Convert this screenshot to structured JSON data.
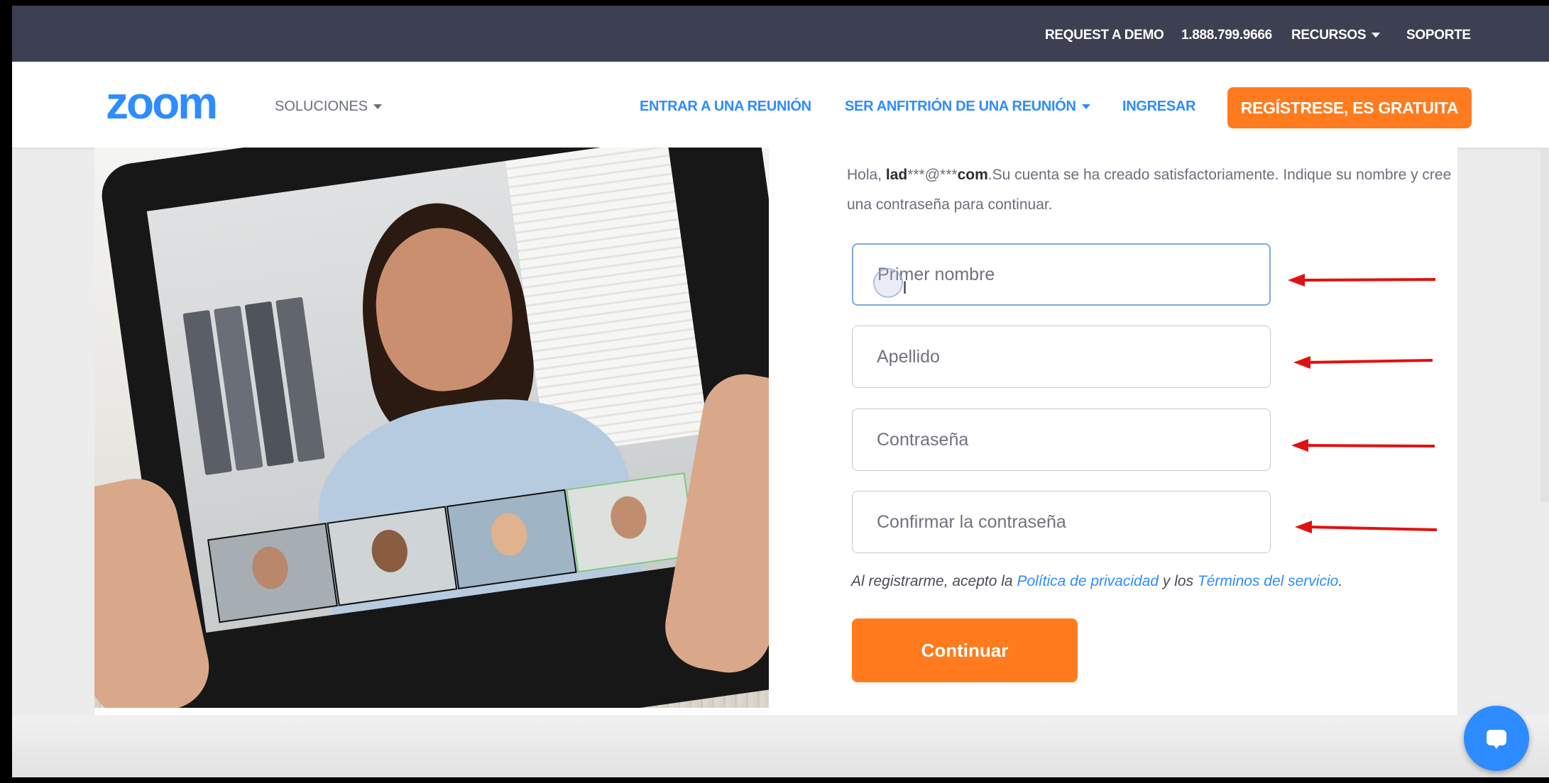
{
  "topbar": {
    "request_demo": "REQUEST A DEMO",
    "phone": "1.888.799.9666",
    "resources": "RECURSOS",
    "support": "SOPORTE"
  },
  "nav": {
    "logo": "zoom",
    "solutions": "SOLUCIONES",
    "join": "ENTRAR A UNA REUNIÓN",
    "host": "SER ANFITRIÓN DE UNA REUNIÓN",
    "signin": "INGRESAR",
    "signup": "REGÍSTRESE, ES GRATUITA"
  },
  "form": {
    "intro_hello": "Hola, ",
    "intro_email_a": "lad",
    "intro_email_b": "***@***",
    "intro_email_c": "com",
    "intro_rest": ".Su cuenta se ha creado satisfactoriamente. Indique su nombre y cree una contraseña para continuar.",
    "first_name_placeholder": "Primer nombre",
    "last_name_placeholder": "Apellido",
    "password_placeholder": "Contraseña",
    "confirm_password_placeholder": "Confirmar la contraseña",
    "terms_prefix": "Al registrarme, acepto la ",
    "privacy_link": "Política de privacidad",
    "terms_middle": " y los ",
    "terms_link": "Términos del servicio",
    "terms_suffix": ".",
    "continue_label": "Continuar"
  },
  "colors": {
    "brand_blue": "#2d8cff",
    "accent_orange": "#ff7b1d",
    "topbar_bg": "#3d3f52",
    "annotation_red": "#e0120f"
  }
}
